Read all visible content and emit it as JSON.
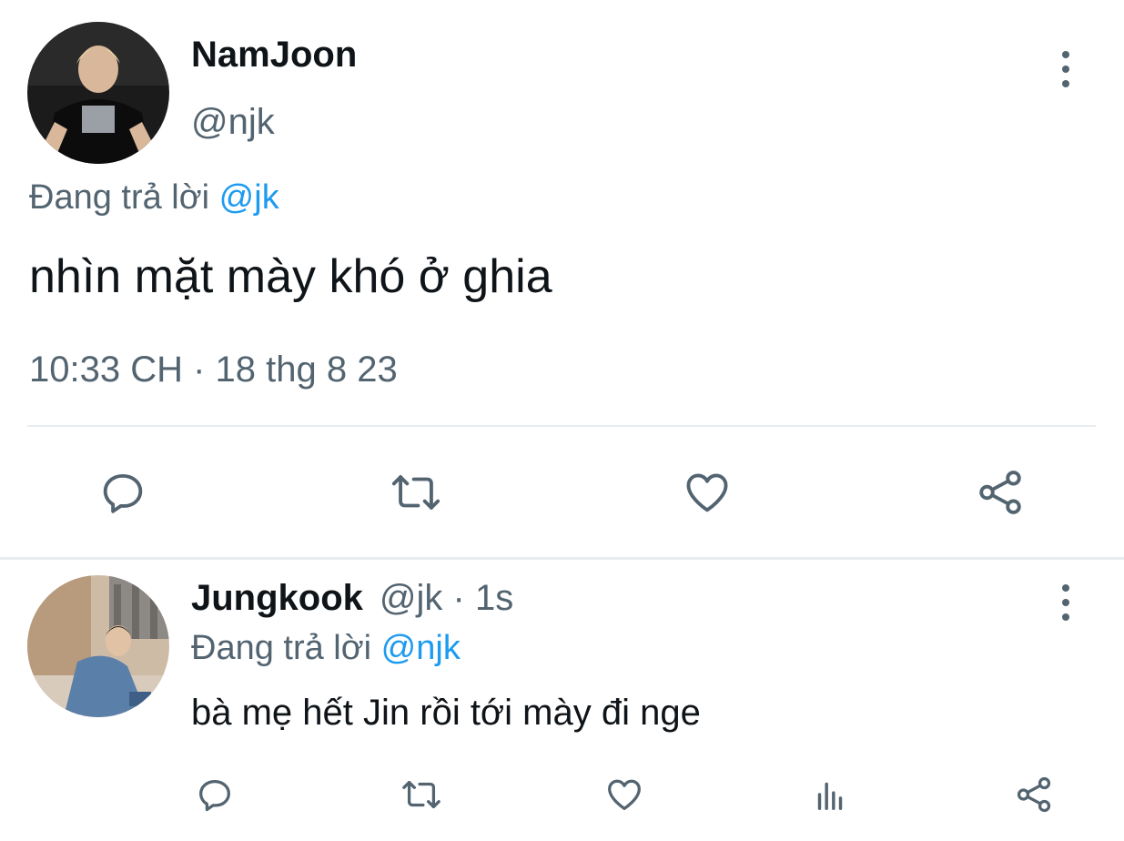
{
  "main_tweet": {
    "display_name": "NamJoon",
    "handle": "@njk",
    "replying_prefix": "Đang trả lời ",
    "replying_to": "@jk",
    "text": "nhìn mặt mày khó ở ghia",
    "timestamp": "10:33 CH · 18 thg 8 23",
    "actions": [
      "reply-icon",
      "retweet-icon",
      "like-icon",
      "share-icon"
    ]
  },
  "reply_tweet": {
    "display_name": "Jungkook",
    "handle_time": "@jk · 1s",
    "replying_prefix": "Đang trả lời ",
    "replying_to": "@njk",
    "text": "bà mẹ hết Jin rồi tới mày đi nge",
    "actions": [
      "reply-icon",
      "retweet-icon",
      "like-icon",
      "analytics-icon",
      "share-icon"
    ]
  },
  "colors": {
    "text_primary": "#0f1419",
    "text_secondary": "#536471",
    "link": "#1d9bf0",
    "divider": "#e6ecf0"
  }
}
